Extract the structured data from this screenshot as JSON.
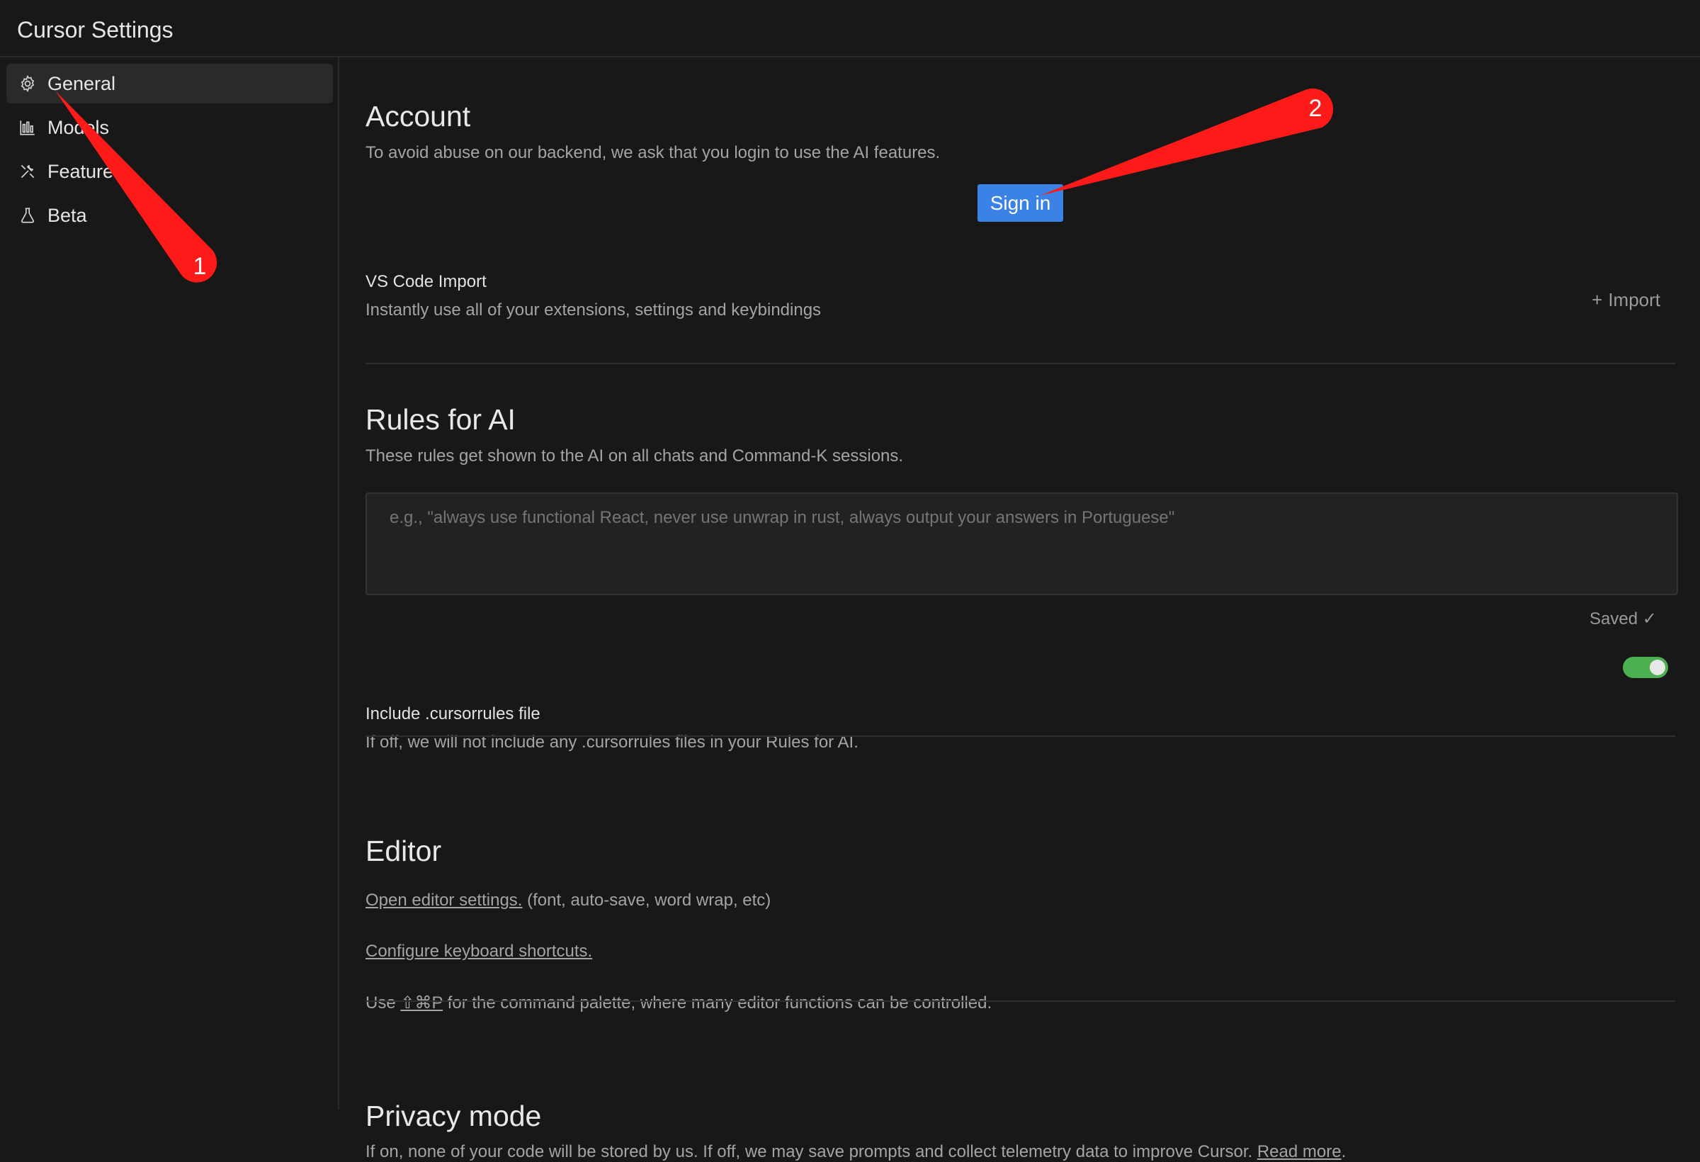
{
  "window": {
    "title": "Cursor Settings"
  },
  "sidebar": {
    "items": [
      {
        "label": "General",
        "icon": "gear-icon",
        "active": true
      },
      {
        "label": "Models",
        "icon": "bar-chart-icon",
        "active": false
      },
      {
        "label": "Features",
        "icon": "tools-icon",
        "active": false
      },
      {
        "label": "Beta",
        "icon": "flask-icon",
        "active": false
      }
    ]
  },
  "account": {
    "heading": "Account",
    "description": "To avoid abuse on our backend, we ask that you login to use the AI features.",
    "sign_in_label": "Sign in"
  },
  "vscode_import": {
    "title": "VS Code Import",
    "description": "Instantly use all of your extensions, settings and keybindings",
    "import_label": "Import"
  },
  "rules": {
    "heading": "Rules for AI",
    "description": "These rules get shown to the AI on all chats and Command-K sessions.",
    "placeholder": "e.g., \"always use functional React, never use unwrap in rust, always output your answers in Portuguese\"",
    "saved_label": "Saved ✓",
    "cursorrules_title": "Include .cursorrules file",
    "cursorrules_desc": "If off, we will not include any .cursorrules files in your Rules for AI.",
    "cursorrules_enabled": true
  },
  "editor": {
    "heading": "Editor",
    "open_settings_link": "Open editor settings.",
    "open_settings_suffix": " (font, auto-save, word wrap, etc)",
    "shortcuts_link": "Configure keyboard shortcuts.",
    "palette_prefix": "Use ",
    "palette_shortcut": "⇧⌘P",
    "palette_suffix": " for the command palette, where many editor functions can be controlled."
  },
  "privacy": {
    "heading": "Privacy mode",
    "description": "If on, none of your code will be stored by us. If off, we may save prompts and collect telemetry data to improve Cursor.",
    "read_more": "Read more",
    "period": "."
  },
  "annotations": [
    {
      "label": "1"
    },
    {
      "label": "2"
    }
  ],
  "colors": {
    "accent": "#3b82e6",
    "toggle_on": "#4caf50",
    "annotation": "#ff1a1a"
  }
}
